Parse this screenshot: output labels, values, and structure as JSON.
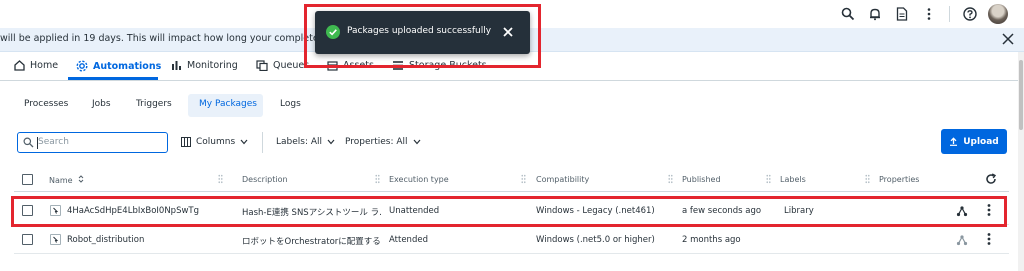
{
  "banner": {
    "text": "will be applied in 19 days. This will impact how long your completed jobs are p"
  },
  "toast": {
    "message": "Packages uploaded successfully"
  },
  "main_nav": {
    "items": [
      {
        "label": "Home",
        "icon": "home-icon"
      },
      {
        "label": "Automations",
        "icon": "automations-icon"
      },
      {
        "label": "Monitoring",
        "icon": "monitoring-icon"
      },
      {
        "label": "Queues",
        "icon": "queues-icon"
      },
      {
        "label": "Assets",
        "icon": "assets-icon"
      },
      {
        "label": "Storage Buckets",
        "icon": "storage-buckets-icon"
      }
    ],
    "active": "Automations"
  },
  "sub_tabs": {
    "items": [
      "Processes",
      "Jobs",
      "Triggers",
      "My Packages",
      "Logs"
    ],
    "active": "My Packages"
  },
  "toolbar": {
    "search_placeholder": "Search",
    "columns_label": "Columns",
    "labels_filter": "Labels: All",
    "properties_filter": "Properties: All",
    "upload_label": "Upload"
  },
  "table": {
    "columns": [
      "Name",
      "Description",
      "Execution type",
      "Compatibility",
      "Published",
      "Labels",
      "Properties"
    ],
    "rows": [
      {
        "name": "4HaAcSdHpE4LbIxBoI0NpSwTg",
        "description": "Hash-E連携 SNSアシストツール ラ...",
        "execution_type": "Unattended",
        "compatibility": "Windows - Legacy (.net461)",
        "published": "a few seconds ago",
        "labels": "Library",
        "properties": ""
      },
      {
        "name": "Robot_distribution",
        "description": "ロボットをOrchestratorに配置する",
        "execution_type": "Attended",
        "compatibility": "Windows (.net5.0 or higher)",
        "published": "2 months ago",
        "labels": "",
        "properties": ""
      }
    ]
  },
  "colors": {
    "accent": "#0067df",
    "highlight": "#e3252e",
    "toast_bg": "#25303a",
    "success": "#3fb950"
  }
}
